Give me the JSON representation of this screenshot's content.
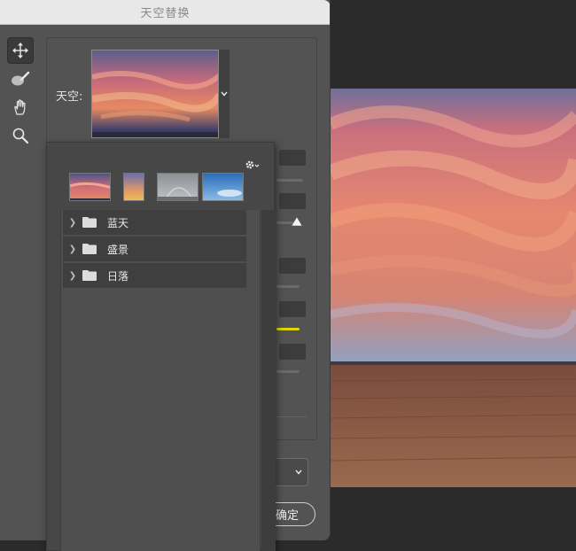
{
  "window": {
    "title": "天空替换"
  },
  "tools": [
    {
      "name": "move-tool",
      "icon": "move-icon",
      "active": true
    },
    {
      "name": "sky-brush-tool",
      "icon": "brush-icon",
      "active": false
    },
    {
      "name": "hand-tool",
      "icon": "hand-icon",
      "active": false
    },
    {
      "name": "zoom-tool",
      "icon": "zoom-icon",
      "active": false
    }
  ],
  "sky": {
    "label": "天空:"
  },
  "popup": {
    "gear_icon": "gear-icon",
    "folders": [
      {
        "label": "蓝天"
      },
      {
        "label": "盛景"
      },
      {
        "label": "日落"
      }
    ]
  },
  "footer": {
    "ok_label": "确定"
  },
  "colors": {
    "accent_yellow": "#e2d500",
    "dialog_bg": "#535353",
    "canvas_bg": "#2b2b2b"
  }
}
